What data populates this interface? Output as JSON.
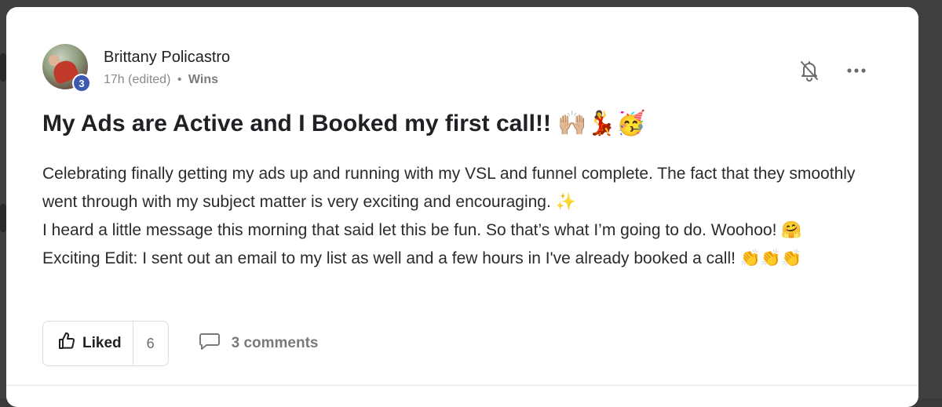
{
  "post": {
    "author": "Brittany Policastro",
    "level": "3",
    "time": "17h (edited)",
    "separator": "•",
    "category": "Wins",
    "title": "My Ads are Active and I Booked my first call!! 🙌🏼💃🥳",
    "body_lines": [
      "Celebrating finally getting my ads up and running with my VSL and funnel complete. The fact that they smoothly went through with my subject matter is very exciting and encouraging. ✨",
      "I heard a little message this morning that said let this be fun. So that’s what I’m going to do. Woohoo! 🤗",
      "Exciting Edit: I sent out an email to my list as well and a few hours in I've already booked a call! 👏👏👏"
    ]
  },
  "footer": {
    "like_label": "Liked",
    "like_count": "6",
    "comments_label": "3 comments"
  },
  "icons": {
    "bell": "bell-off-icon",
    "more": "more-horizontal-icon",
    "like": "thumbs-up-icon",
    "comment": "comment-icon"
  },
  "colors": {
    "level_badge": "#3d59b0",
    "text": "#202124",
    "muted": "#8a8a8a"
  }
}
